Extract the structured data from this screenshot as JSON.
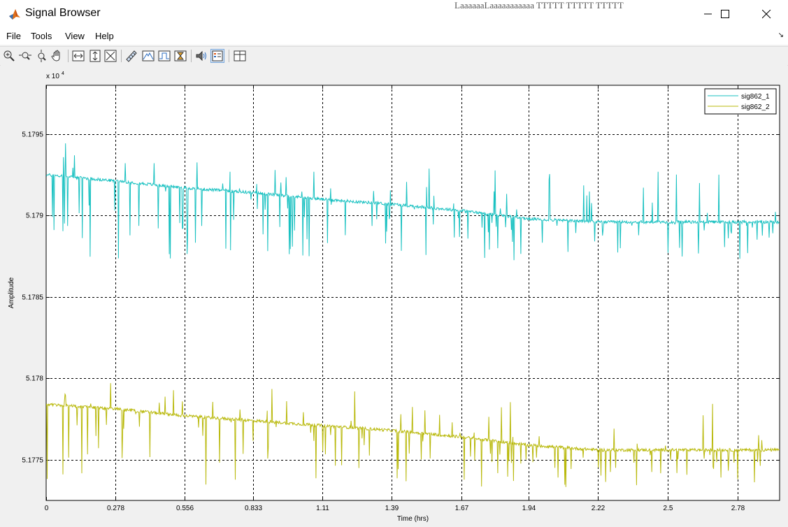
{
  "window": {
    "title": "Signal Browser",
    "background_text": "LaaaaaaLaaaaaaaaaaa  TTTTT TTTTT TTTTT"
  },
  "menu": {
    "items": [
      "File",
      "Tools",
      "View",
      "Help"
    ]
  },
  "toolbar": {
    "icons": [
      "zoom-in-icon",
      "zoom-x-icon",
      "zoom-y-icon",
      "pan-hand-icon",
      "fit-x-icon",
      "fit-y-icon",
      "fit-all-icon",
      "ruler-icon",
      "peak-finder-icon",
      "bilevel-icon",
      "distortion-icon",
      "audio-icon",
      "legend-icon",
      "layout-icon"
    ]
  },
  "chart_data": {
    "type": "line",
    "xlabel": "Time (hrs)",
    "ylabel": "Amplitude",
    "exponent_label": "x 10",
    "exponent_power": "4",
    "xlim": [
      0,
      2.95
    ],
    "ylim": [
      5.17725,
      5.1798
    ],
    "xticks": [
      "0",
      "0.278",
      "0.556",
      "0.833",
      "1.11",
      "1.39",
      "1.67",
      "1.94",
      "2.22",
      "2.5",
      "2.78"
    ],
    "xtick_values": [
      0,
      0.278,
      0.556,
      0.833,
      1.11,
      1.39,
      1.67,
      1.94,
      2.22,
      2.5,
      2.78
    ],
    "yticks": [
      "5.1775",
      "5.178",
      "5.1785",
      "5.179",
      "5.1795"
    ],
    "ytick_values": [
      5.1775,
      5.178,
      5.1785,
      5.179,
      5.1795
    ],
    "grid": true,
    "legend_position": "top-right",
    "series": [
      {
        "name": "sig862_1",
        "color": "#19c1c1",
        "trend": [
          [
            0,
            5.17925
          ],
          [
            0.3,
            5.17921
          ],
          [
            0.556,
            5.17917
          ],
          [
            0.833,
            5.17914
          ],
          [
            1.11,
            5.1791
          ],
          [
            1.39,
            5.17907
          ],
          [
            1.67,
            5.17903
          ],
          [
            1.94,
            5.17898
          ],
          [
            2.22,
            5.17896
          ],
          [
            2.5,
            5.17896
          ],
          [
            2.95,
            5.17896
          ]
        ],
        "spike_max": 5.17948,
        "spike_min": 5.17871
      },
      {
        "name": "sig862_2",
        "color": "#b9b90c",
        "trend": [
          [
            0,
            5.17784
          ],
          [
            0.3,
            5.17781
          ],
          [
            0.556,
            5.17777
          ],
          [
            0.833,
            5.17774
          ],
          [
            1.11,
            5.17771
          ],
          [
            1.39,
            5.17768
          ],
          [
            1.67,
            5.17764
          ],
          [
            1.94,
            5.17759
          ],
          [
            2.22,
            5.17756
          ],
          [
            2.5,
            5.17756
          ],
          [
            2.95,
            5.17756
          ]
        ],
        "spike_max": 5.17808,
        "spike_min": 5.17732
      }
    ]
  }
}
